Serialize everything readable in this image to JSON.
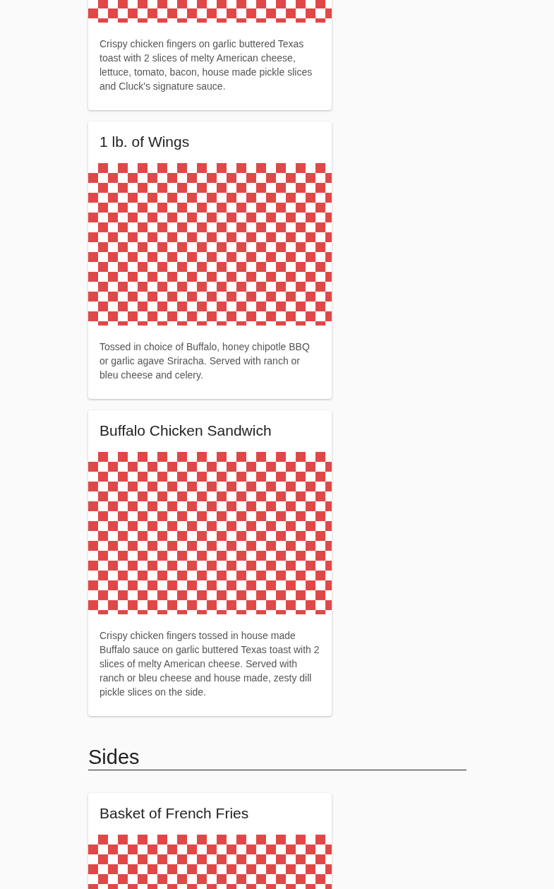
{
  "sections": [
    {
      "items": [
        {
          "description": "Crispy chicken fingers on garlic buttered Texas toast with 2 slices of melty American cheese, lettuce, tomato, bacon, house made pickle slices and Cluck's signature sauce."
        },
        {
          "title": "1 lb. of Wings",
          "description": "Tossed in choice of Buffalo, honey chipotle BBQ or garlic agave Sriracha. Served with ranch or bleu cheese and celery."
        },
        {
          "title": "Buffalo Chicken Sandwich",
          "description": "Crispy chicken fingers tossed in house made Buffalo sauce on garlic buttered Texas toast with 2 slices of melty American cheese. Served with ranch or bleu cheese and house made, zesty dill pickle slices on the side."
        }
      ]
    },
    {
      "heading": "Sides",
      "items": [
        {
          "title": "Basket of French Fries"
        }
      ]
    }
  ]
}
